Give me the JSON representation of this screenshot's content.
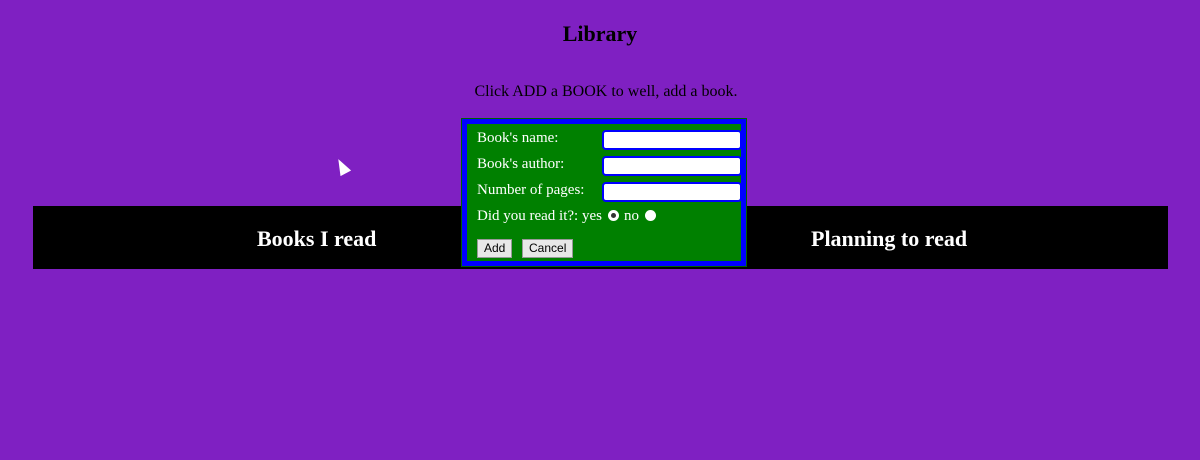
{
  "title": "Library",
  "intro": "Click ADD a BOOK to well, add a book.",
  "columns": {
    "read": "Books I read",
    "planning": "Planning to read"
  },
  "form": {
    "name_label": "Book's name:",
    "name_value": "",
    "author_label": "Book's author:",
    "author_value": "",
    "pages_label": "Number of pages:",
    "pages_value": "",
    "read_label": "Did you read it?:",
    "yes_label": "yes",
    "no_label": "no",
    "selected": "yes",
    "add": "Add",
    "cancel": "Cancel"
  }
}
